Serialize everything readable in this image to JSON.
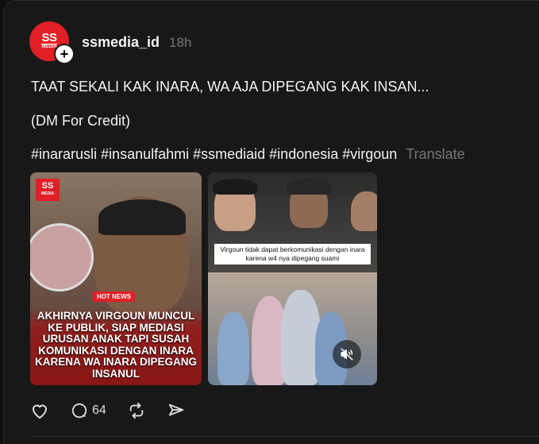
{
  "post": {
    "author": {
      "username": "ssmedia_id",
      "time": "18h",
      "avatar_text": "SS",
      "avatar_subtext": "MEDIA"
    },
    "caption_lines": [
      "TAAT SEKALI KAK INARA, WA AJA DIPEGANG KAK INSAN...",
      "(DM For Credit)"
    ],
    "hashtags": [
      "#inararusli",
      "#insanulfahmi",
      "#ssmediaid",
      "#indonesia",
      "#virgoun"
    ],
    "translate_label": "Translate",
    "media": [
      {
        "badge_top": "SS",
        "badge_bottom": "MEDIA",
        "tag": "HOT NEWS",
        "headline": "AKHIRNYA VIRGOUN MUNCUL KE PUBLIK, SIAP MEDIASI URUSAN ANAK TAPI SUSAH KOMUNIKASI DENGAN INARA KARENA WA INARA DIPEGANG INSANUL"
      },
      {
        "overlay_text": "Virgoun tidak dapat berkomunikasi dengan inara karena w4 nya dipegang suami",
        "mute_icon": "speaker-muted-icon"
      }
    ],
    "actions": {
      "like_icon": "heart-icon",
      "comment_icon": "comment-icon",
      "comment_count": "64",
      "repost_icon": "repost-icon",
      "share_icon": "share-icon"
    }
  },
  "colors": {
    "background": "#181818",
    "brand_red": "#e11f26",
    "muted_text": "#777777"
  }
}
